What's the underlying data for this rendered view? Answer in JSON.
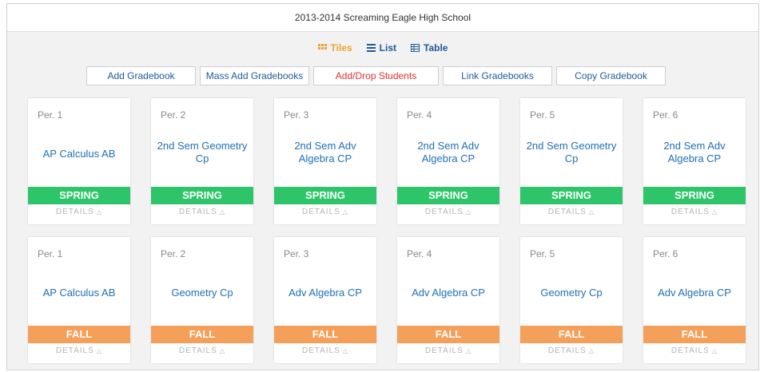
{
  "header": {
    "title": "2013-2014 Screaming Eagle High School"
  },
  "view_tabs": [
    {
      "label": "Tiles",
      "icon": "tiles-icon",
      "active": true
    },
    {
      "label": "List",
      "icon": "list-icon",
      "active": false
    },
    {
      "label": "Table",
      "icon": "table-icon",
      "active": false
    }
  ],
  "actions": [
    {
      "label": "Add Gradebook"
    },
    {
      "label": "Mass Add Gradebooks"
    },
    {
      "label": "Add/Drop Students",
      "color": "#e03030"
    },
    {
      "label": "Link Gradebooks"
    },
    {
      "label": "Copy Gradebook"
    }
  ],
  "rows": [
    {
      "term": "SPRING",
      "color": "#2ec56a",
      "tiles": [
        {
          "period": "Per. 1",
          "course": "AP Calculus AB"
        },
        {
          "period": "Per. 2",
          "course": "2nd Sem Geometry Cp"
        },
        {
          "period": "Per. 3",
          "course": "2nd Sem Adv Algebra CP"
        },
        {
          "period": "Per. 4",
          "course": "2nd Sem Adv Algebra CP"
        },
        {
          "period": "Per. 5",
          "course": "2nd Sem Geometry Cp"
        },
        {
          "period": "Per. 6",
          "course": "2nd Sem Adv Algebra CP"
        }
      ]
    },
    {
      "term": "FALL",
      "color": "#f5a05a",
      "tiles": [
        {
          "period": "Per. 1",
          "course": "AP Calculus AB"
        },
        {
          "period": "Per. 2",
          "course": "Geometry Cp"
        },
        {
          "period": "Per. 3",
          "course": "Adv Algebra CP"
        },
        {
          "period": "Per. 4",
          "course": "Adv Algebra CP"
        },
        {
          "period": "Per. 5",
          "course": "Geometry Cp"
        },
        {
          "period": "Per. 6",
          "course": "Adv Algebra CP"
        }
      ]
    }
  ],
  "details_label": "DETAILS",
  "colors": {
    "link": "#1f6fb5",
    "active_tab": "#f0a030"
  }
}
